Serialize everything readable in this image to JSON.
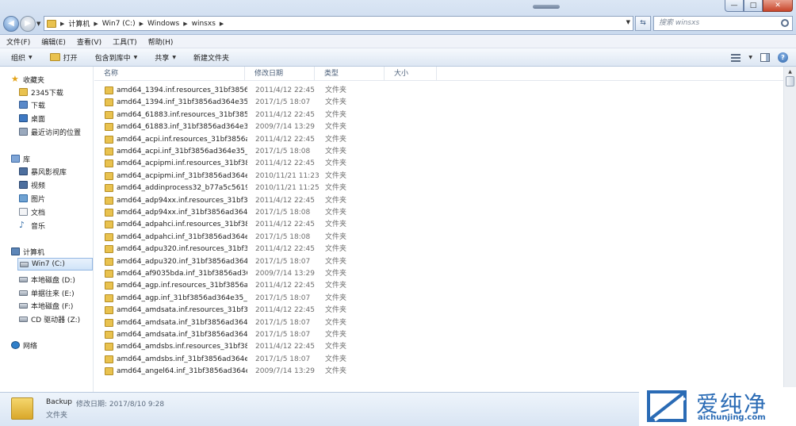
{
  "window": {
    "min": "—",
    "max": "□",
    "close": "✕"
  },
  "address": {
    "crumbs": [
      "计算机",
      "Win7 (C:)",
      "Windows",
      "winsxs"
    ],
    "search_placeholder": "搜索 winsxs"
  },
  "menu": [
    "文件(F)",
    "编辑(E)",
    "查看(V)",
    "工具(T)",
    "帮助(H)"
  ],
  "toolbar": {
    "organize": "组织",
    "open": "打开",
    "include_library": "包含到库中",
    "share": "共享",
    "new_folder": "新建文件夹"
  },
  "nav": {
    "favorites": "收藏夹",
    "favorite_items": [
      "2345下载",
      "下载",
      "桌面",
      "最近访问的位置"
    ],
    "libraries": "库",
    "library_items": [
      "暴风影视库",
      "视频",
      "图片",
      "文档",
      "音乐"
    ],
    "computer": "计算机",
    "computer_items": [
      "Win7 (C:)",
      "本地磁盘 (D:)",
      "单据往来 (E:)",
      "本地磁盘 (F:)",
      "CD 驱动器 (Z:)"
    ],
    "network": "网络"
  },
  "columns": [
    "名称",
    "修改日期",
    "类型",
    "大小"
  ],
  "files": [
    {
      "name": "amd64_1394.inf.resources_31bf3856a...",
      "date": "2011/4/12 22:45",
      "type": "文件夹"
    },
    {
      "name": "amd64_1394.inf_31bf3856ad364e35_...",
      "date": "2017/1/5 18:07",
      "type": "文件夹"
    },
    {
      "name": "amd64_61883.inf.resources_31bf3856...",
      "date": "2011/4/12 22:45",
      "type": "文件夹"
    },
    {
      "name": "amd64_61883.inf_31bf3856ad364e35...",
      "date": "2009/7/14 13:29",
      "type": "文件夹"
    },
    {
      "name": "amd64_acpi.inf.resources_31bf3856a...",
      "date": "2011/4/12 22:45",
      "type": "文件夹"
    },
    {
      "name": "amd64_acpi.inf_31bf3856ad364e35_6...",
      "date": "2017/1/5 18:08",
      "type": "文件夹"
    },
    {
      "name": "amd64_acpipmi.inf.resources_31bf38...",
      "date": "2011/4/12 22:45",
      "type": "文件夹"
    },
    {
      "name": "amd64_acpipmi.inf_31bf3856ad364e3...",
      "date": "2010/11/21 11:23",
      "type": "文件夹"
    },
    {
      "name": "amd64_addinprocess32_b77a5c5619...",
      "date": "2010/11/21 11:25",
      "type": "文件夹"
    },
    {
      "name": "amd64_adp94xx.inf.resources_31bf38...",
      "date": "2011/4/12 22:45",
      "type": "文件夹"
    },
    {
      "name": "amd64_adp94xx.inf_31bf3856ad364e...",
      "date": "2017/1/5 18:08",
      "type": "文件夹"
    },
    {
      "name": "amd64_adpahci.inf.resources_31bf38...",
      "date": "2011/4/12 22:45",
      "type": "文件夹"
    },
    {
      "name": "amd64_adpahci.inf_31bf3856ad364e3...",
      "date": "2017/1/5 18:08",
      "type": "文件夹"
    },
    {
      "name": "amd64_adpu320.inf.resources_31bf3...",
      "date": "2011/4/12 22:45",
      "type": "文件夹"
    },
    {
      "name": "amd64_adpu320.inf_31bf3856ad364e...",
      "date": "2017/1/5 18:07",
      "type": "文件夹"
    },
    {
      "name": "amd64_af9035bda.inf_31bf3856ad36...",
      "date": "2009/7/14 13:29",
      "type": "文件夹"
    },
    {
      "name": "amd64_agp.inf.resources_31bf3856a...",
      "date": "2011/4/12 22:45",
      "type": "文件夹"
    },
    {
      "name": "amd64_agp.inf_31bf3856ad364e35_6...",
      "date": "2017/1/5 18:07",
      "type": "文件夹"
    },
    {
      "name": "amd64_amdsata.inf.resources_31bf38...",
      "date": "2011/4/12 22:45",
      "type": "文件夹"
    },
    {
      "name": "amd64_amdsata.inf_31bf3856ad364e...",
      "date": "2017/1/5 18:07",
      "type": "文件夹"
    },
    {
      "name": "amd64_amdsata.inf_31bf3856ad364e...",
      "date": "2017/1/5 18:07",
      "type": "文件夹"
    },
    {
      "name": "amd64_amdsbs.inf.resources_31bf38...",
      "date": "2011/4/12 22:45",
      "type": "文件夹"
    },
    {
      "name": "amd64_amdsbs.inf_31bf3856ad364e3...",
      "date": "2017/1/5 18:07",
      "type": "文件夹"
    },
    {
      "name": "amd64_angel64.inf_31bf3856ad364e3...",
      "date": "2009/7/14 13:29",
      "type": "文件夹"
    }
  ],
  "details": {
    "name": "Backup",
    "modified_label": "修改日期: 2017/8/10 9:28",
    "type": "文件夹"
  },
  "watermark": {
    "text": "爱纯净",
    "url": "aichunjing.com"
  },
  "colors": {
    "accent": "#2a6bb5",
    "folder": "#e9c24f"
  }
}
